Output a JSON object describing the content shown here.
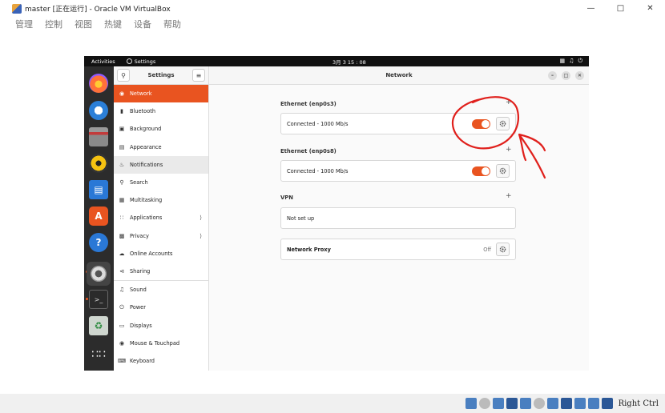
{
  "host": {
    "window_title": "master [正在运行] - Oracle VM VirtualBox",
    "menu": [
      "管理",
      "控制",
      "视图",
      "热键",
      "设备",
      "帮助"
    ],
    "status_right": "Right Ctrl"
  },
  "topbar": {
    "activities": "Activities",
    "app_name": "Settings",
    "clock": "3月 3  15 : 08"
  },
  "dock": {
    "items": [
      "firefox-icon",
      "thunderbird-icon",
      "files-icon",
      "rhythmbox-icon",
      "writer-icon",
      "software-icon",
      "help-icon",
      "settings-icon",
      "terminal-icon",
      "trash-icon",
      "apps-grid-icon"
    ]
  },
  "sidebar": {
    "title": "Settings",
    "items": [
      {
        "label": "Network",
        "icon": "network-icon"
      },
      {
        "label": "Bluetooth",
        "icon": "bluetooth-icon"
      },
      {
        "label": "Background",
        "icon": "background-icon"
      },
      {
        "label": "Appearance",
        "icon": "appearance-icon"
      },
      {
        "label": "Notifications",
        "icon": "bell-icon"
      },
      {
        "label": "Search",
        "icon": "search-icon"
      },
      {
        "label": "Multitasking",
        "icon": "multitasking-icon"
      },
      {
        "label": "Applications",
        "icon": "applications-icon"
      },
      {
        "label": "Privacy",
        "icon": "lock-icon"
      },
      {
        "label": "Online Accounts",
        "icon": "cloud-icon"
      },
      {
        "label": "Sharing",
        "icon": "share-icon"
      },
      {
        "label": "Sound",
        "icon": "music-note-icon"
      },
      {
        "label": "Power",
        "icon": "power-icon"
      },
      {
        "label": "Displays",
        "icon": "display-icon"
      },
      {
        "label": "Mouse & Touchpad",
        "icon": "mouse-icon"
      },
      {
        "label": "Keyboard",
        "icon": "keyboard-icon"
      }
    ]
  },
  "main": {
    "title": "Network",
    "ethernet1": {
      "title": "Ethernet (enp0s3)",
      "status": "Connected - 1000 Mb/s",
      "enabled": true
    },
    "ethernet2": {
      "title": "Ethernet (enp0s8)",
      "status": "Connected - 1000 Mb/s",
      "enabled": true
    },
    "vpn": {
      "title": "VPN",
      "status": "Not set up"
    },
    "proxy": {
      "label": "Network Proxy",
      "value": "Off"
    },
    "plus": "+"
  },
  "colors": {
    "accent": "#e95420",
    "annotation": "#e0201c"
  }
}
